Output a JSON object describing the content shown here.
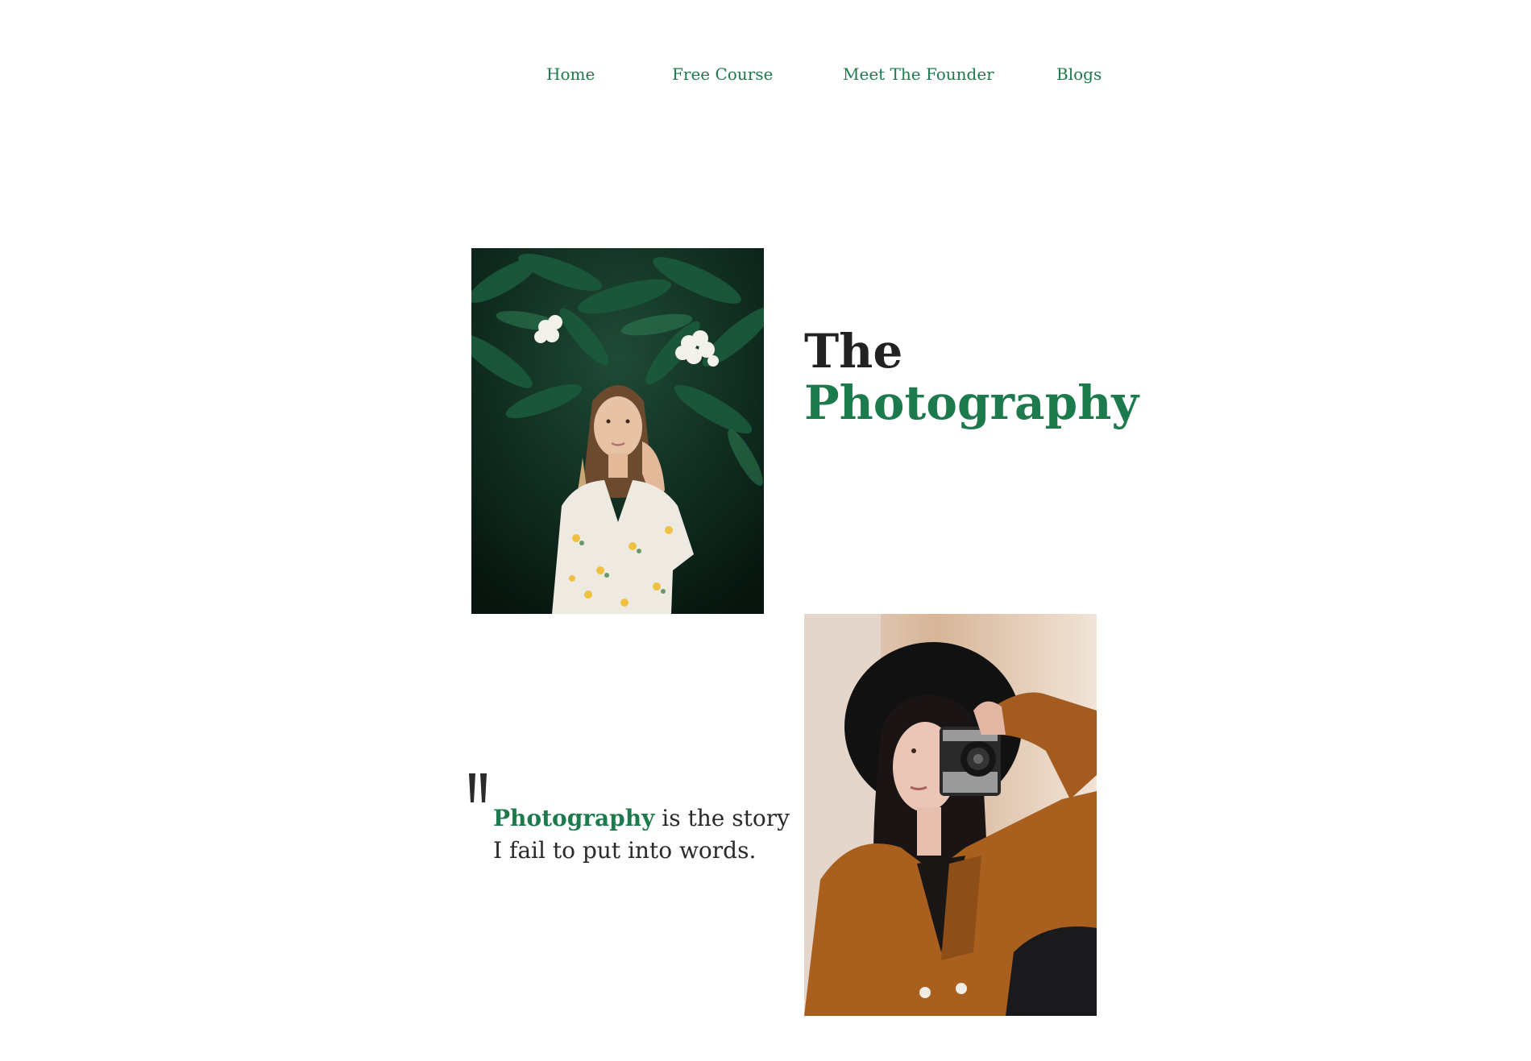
{
  "nav": {
    "items": [
      {
        "label": "Home"
      },
      {
        "label": "Free Course"
      },
      {
        "label": "Meet The Founder"
      },
      {
        "label": "Blogs"
      }
    ]
  },
  "hero": {
    "title_line1": "The",
    "title_line2": "Photography"
  },
  "quote": {
    "highlight": "Photography",
    "rest_line1": " is the story",
    "line2": "I fail to put into words."
  },
  "colors": {
    "accent": "#1d7a4c",
    "text_dark": "#222222",
    "background": "#ffffff"
  },
  "icons": {
    "quote_mark": "quote-mark-icon"
  }
}
